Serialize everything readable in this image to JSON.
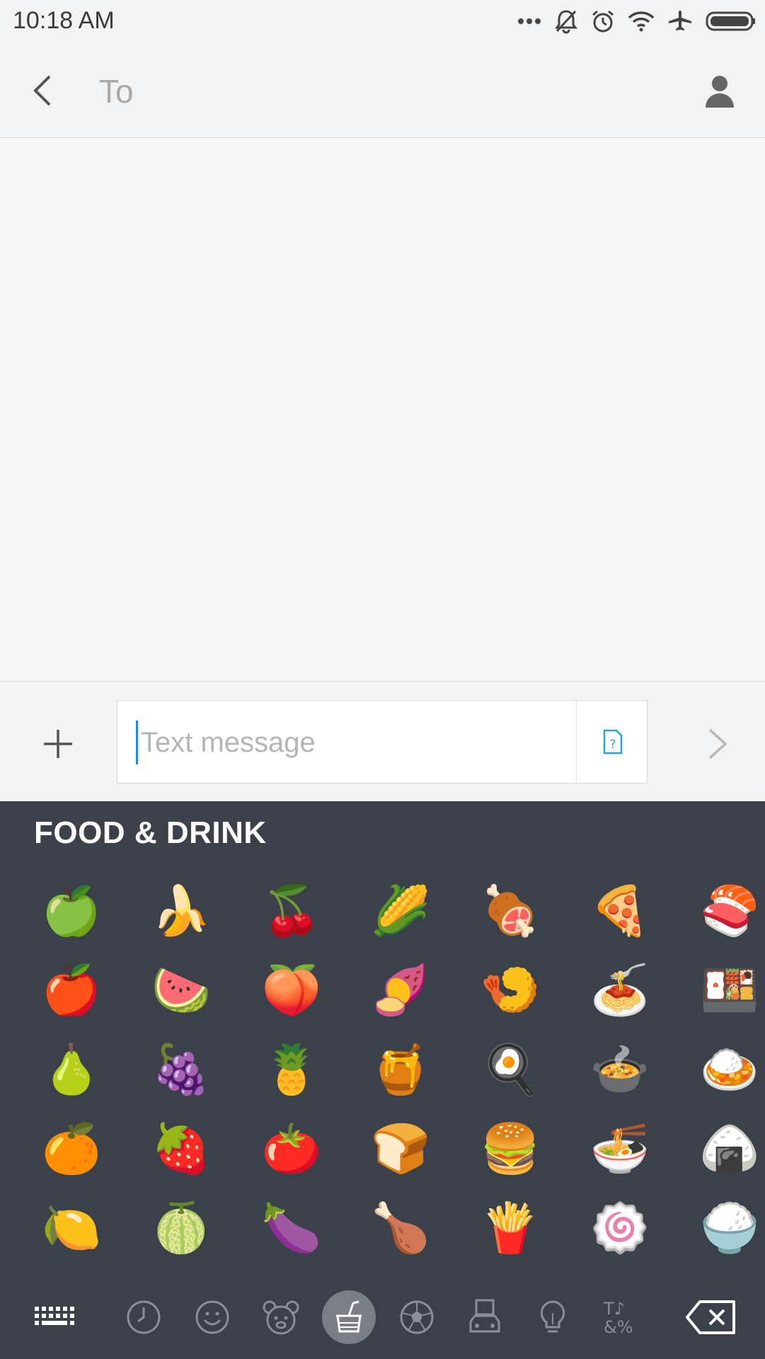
{
  "status_bar": {
    "time": "10:18 AM",
    "icons": [
      "more-dots-icon",
      "silent-bell-icon",
      "alarm-icon",
      "wifi-icon",
      "airplane-icon",
      "battery-icon"
    ]
  },
  "header": {
    "to_label": "To",
    "icons": [
      "back-arrow-icon",
      "contact-person-icon"
    ]
  },
  "composer": {
    "placeholder": "Text message",
    "value": "",
    "icons": [
      "plus-icon",
      "sim-card-icon",
      "send-chevron-icon"
    ]
  },
  "keyboard": {
    "category_title": "FOOD & DRINK",
    "emoji_rows": [
      [
        "🍏",
        "🍌",
        "🍒",
        "🌽",
        "🍖",
        "🍕",
        "🍣"
      ],
      [
        "🍎",
        "🍉",
        "🍑",
        "🍠",
        "🍤",
        "🍝",
        "🍱"
      ],
      [
        "🍐",
        "🍇",
        "🍍",
        "🍯",
        "🍳",
        "🍲",
        "🍛"
      ],
      [
        "🍊",
        "🍓",
        "🍅",
        "🍞",
        "🍔",
        "🍜",
        "🍙"
      ],
      [
        "🍋",
        "🍈",
        "🍆",
        "🍗",
        "🍟",
        "🍥",
        "🍚"
      ]
    ],
    "bottom_bar": [
      {
        "name": "keyboard-toggle-icon",
        "active": false
      },
      {
        "name": "recent-clock-icon",
        "active": false
      },
      {
        "name": "smiley-face-icon",
        "active": false
      },
      {
        "name": "animal-bear-icon",
        "active": false
      },
      {
        "name": "food-drink-icon",
        "active": true
      },
      {
        "name": "sports-ball-icon",
        "active": false
      },
      {
        "name": "travel-car-icon",
        "active": false
      },
      {
        "name": "objects-bulb-icon",
        "active": false
      },
      {
        "name": "symbols-icon",
        "active": false
      },
      {
        "name": "backspace-icon",
        "active": false
      }
    ],
    "symbols_glyph": "T♪\n&%"
  },
  "colors": {
    "status_bg": "#f2f3f4",
    "conversation_bg": "#f7f7f7",
    "keyboard_bg": "#3b414a",
    "accent_blue": "#1e88e5",
    "active_tab_bg": "#7a7f86"
  }
}
